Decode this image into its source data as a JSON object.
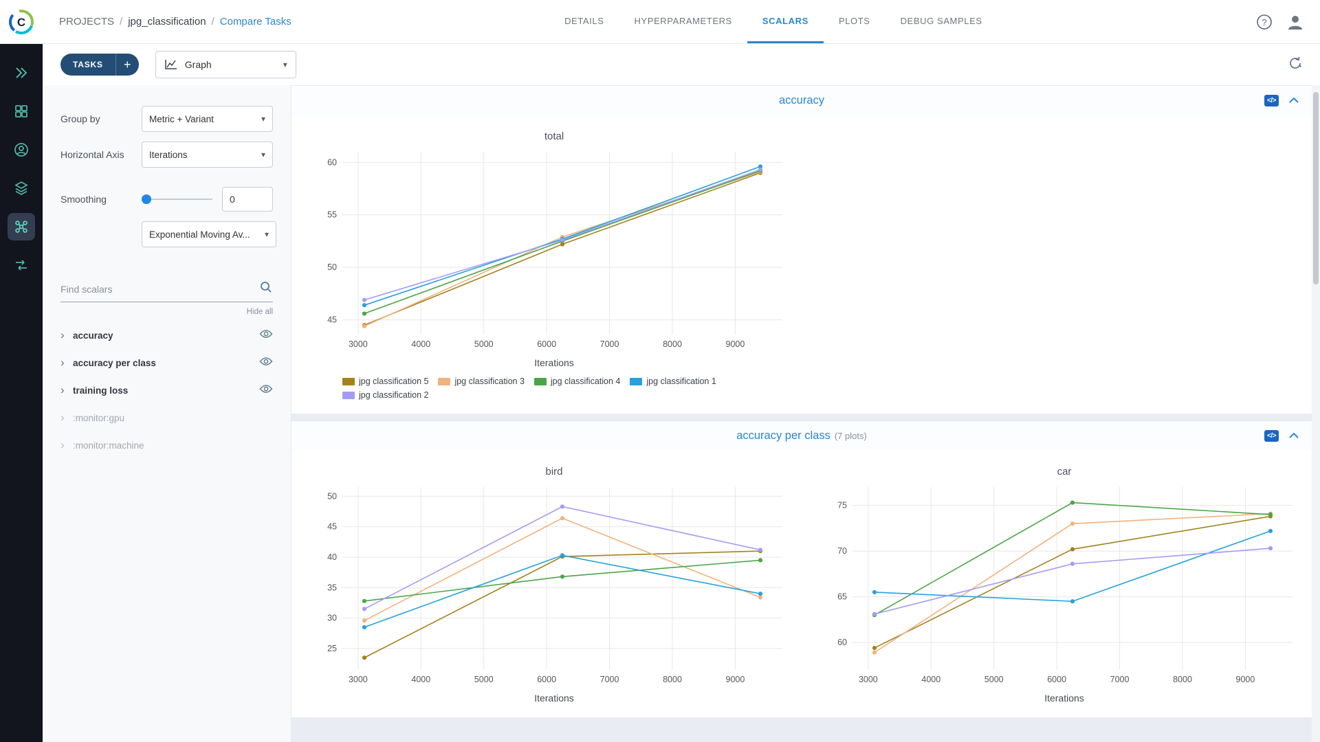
{
  "colors": {
    "accent": "#2b87d0",
    "brand_dark": "#234d74"
  },
  "breadcrumb": {
    "root": "PROJECTS",
    "sep": "/",
    "project": "jpg_classification",
    "page": "Compare Tasks"
  },
  "tabs": [
    {
      "label": "DETAILS",
      "active": false
    },
    {
      "label": "HYPERPARAMETERS",
      "active": false
    },
    {
      "label": "SCALARS",
      "active": true
    },
    {
      "label": "PLOTS",
      "active": false
    },
    {
      "label": "DEBUG SAMPLES",
      "active": false
    }
  ],
  "toolbar": {
    "tasks_label": "TASKS",
    "add_label": "+",
    "view_value": "Graph"
  },
  "controls": {
    "group_by_label": "Group by",
    "group_by_value": "Metric + Variant",
    "horizontal_axis_label": "Horizontal Axis",
    "horizontal_axis_value": "Iterations",
    "smoothing_label": "Smoothing",
    "smoothing_value": "0",
    "smoothing_type_value": "Exponential Moving Av..."
  },
  "scalars": {
    "search_placeholder": "Find scalars",
    "hide_all": "Hide all",
    "items": [
      {
        "label": "accuracy",
        "muted": false,
        "eye": true
      },
      {
        "label": "accuracy per class",
        "muted": false,
        "eye": true
      },
      {
        "label": "training loss",
        "muted": false,
        "eye": true
      },
      {
        "label": ":monitor:gpu",
        "muted": true,
        "eye": false
      },
      {
        "label": ":monitor:machine",
        "muted": true,
        "eye": false
      }
    ]
  },
  "sections": [
    {
      "title": "accuracy",
      "count": ""
    },
    {
      "title": "accuracy per class",
      "count": "(7 plots)"
    }
  ],
  "ui": {
    "code_icon": "</>"
  },
  "chart_data": [
    {
      "type": "line",
      "title": "total",
      "xlabel": "Iterations",
      "x": [
        3100,
        6250,
        9400
      ],
      "xticks": [
        3000,
        4000,
        5000,
        6000,
        7000,
        8000,
        9000
      ],
      "yticks": [
        45,
        50,
        55,
        60
      ],
      "xlim": [
        2750,
        9750
      ],
      "ylim": [
        43.6,
        61
      ],
      "legend": true,
      "series": [
        {
          "name": "jpg classification 5",
          "color": "#a3821a",
          "values": [
            44.5,
            52.2,
            59.0
          ]
        },
        {
          "name": "jpg classification 3",
          "color": "#f2b27e",
          "values": [
            44.4,
            52.9,
            59.1
          ]
        },
        {
          "name": "jpg classification 4",
          "color": "#4aa546",
          "values": [
            45.6,
            52.5,
            59.2
          ]
        },
        {
          "name": "jpg classification 1",
          "color": "#25a1dd",
          "values": [
            46.4,
            52.7,
            59.6
          ]
        },
        {
          "name": "jpg classification 2",
          "color": "#a49cf4",
          "values": [
            46.9,
            52.6,
            59.3
          ]
        }
      ]
    },
    {
      "type": "line",
      "title": "bird",
      "xlabel": "Iterations",
      "x": [
        3100,
        6250,
        9400
      ],
      "xticks": [
        3000,
        4000,
        5000,
        6000,
        7000,
        8000,
        9000
      ],
      "yticks": [
        25,
        30,
        35,
        40,
        45,
        50
      ],
      "xlim": [
        2750,
        9750
      ],
      "ylim": [
        21.5,
        51.5
      ],
      "legend": false,
      "series": [
        {
          "name": "jpg classification 5",
          "color": "#a3821a",
          "values": [
            23.5,
            40.1,
            41.0
          ]
        },
        {
          "name": "jpg classification 3",
          "color": "#f2b27e",
          "values": [
            29.6,
            46.4,
            33.4
          ]
        },
        {
          "name": "jpg classification 4",
          "color": "#4aa546",
          "values": [
            32.8,
            36.8,
            39.5
          ]
        },
        {
          "name": "jpg classification 1",
          "color": "#25a1dd",
          "values": [
            28.5,
            40.3,
            34.0
          ]
        },
        {
          "name": "jpg classification 2",
          "color": "#a49cf4",
          "values": [
            31.5,
            48.3,
            41.2
          ]
        }
      ]
    },
    {
      "type": "line",
      "title": "car",
      "xlabel": "Iterations",
      "x": [
        3100,
        6250,
        9400
      ],
      "xticks": [
        3000,
        4000,
        5000,
        6000,
        7000,
        8000,
        9000
      ],
      "yticks": [
        60,
        65,
        70,
        75
      ],
      "xlim": [
        2750,
        9750
      ],
      "ylim": [
        57,
        77
      ],
      "legend": false,
      "series": [
        {
          "name": "jpg classification 5",
          "color": "#a3821a",
          "values": [
            59.4,
            70.2,
            73.8
          ]
        },
        {
          "name": "jpg classification 3",
          "color": "#f2b27e",
          "values": [
            58.9,
            73.0,
            74.1
          ]
        },
        {
          "name": "jpg classification 4",
          "color": "#4aa546",
          "values": [
            63.0,
            75.3,
            74.0
          ]
        },
        {
          "name": "jpg classification 1",
          "color": "#25a1dd",
          "values": [
            65.5,
            64.5,
            72.2
          ]
        },
        {
          "name": "jpg classification 2",
          "color": "#a49cf4",
          "values": [
            63.1,
            68.6,
            70.3
          ]
        }
      ]
    }
  ]
}
